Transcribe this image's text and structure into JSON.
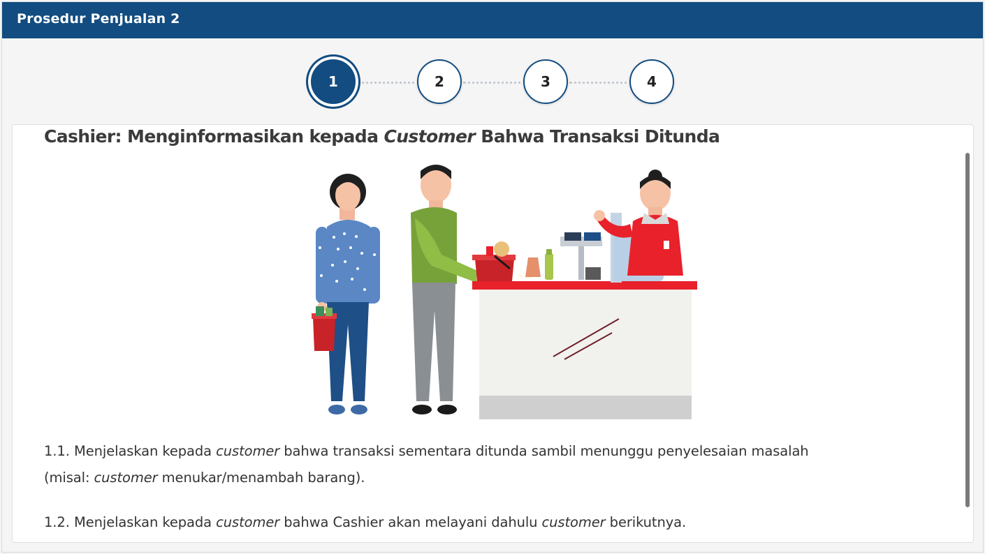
{
  "header": {
    "title": "Prosedur Penjualan 2"
  },
  "stepper": {
    "steps": [
      {
        "label": "1",
        "active": true
      },
      {
        "label": "2",
        "active": false
      },
      {
        "label": "3",
        "active": false
      },
      {
        "label": "4",
        "active": false
      }
    ]
  },
  "content": {
    "title_part1": "Cashier: Menginformasikan kepada ",
    "title_italic": "Customer",
    "title_part2": " Bahwa Transaksi Ditunda",
    "items": [
      {
        "number": "1.1.",
        "segments": [
          "Menjelaskan kepada ",
          "customer",
          " bahwa transaksi sementara ditunda sambil menunggu penyelesaian masalah"
        ],
        "line2": [
          "(misal: ",
          "customer",
          " menukar/menambah barang)."
        ]
      },
      {
        "number": "1.2.",
        "segments": [
          "Menjelaskan kepada ",
          "customer",
          " bahwa Cashier akan melayani dahulu ",
          "customer",
          " berikutnya."
        ]
      }
    ]
  },
  "colors": {
    "header_bg": "#124c80",
    "counter_red": "#e8212b",
    "accent": "#124c80"
  }
}
